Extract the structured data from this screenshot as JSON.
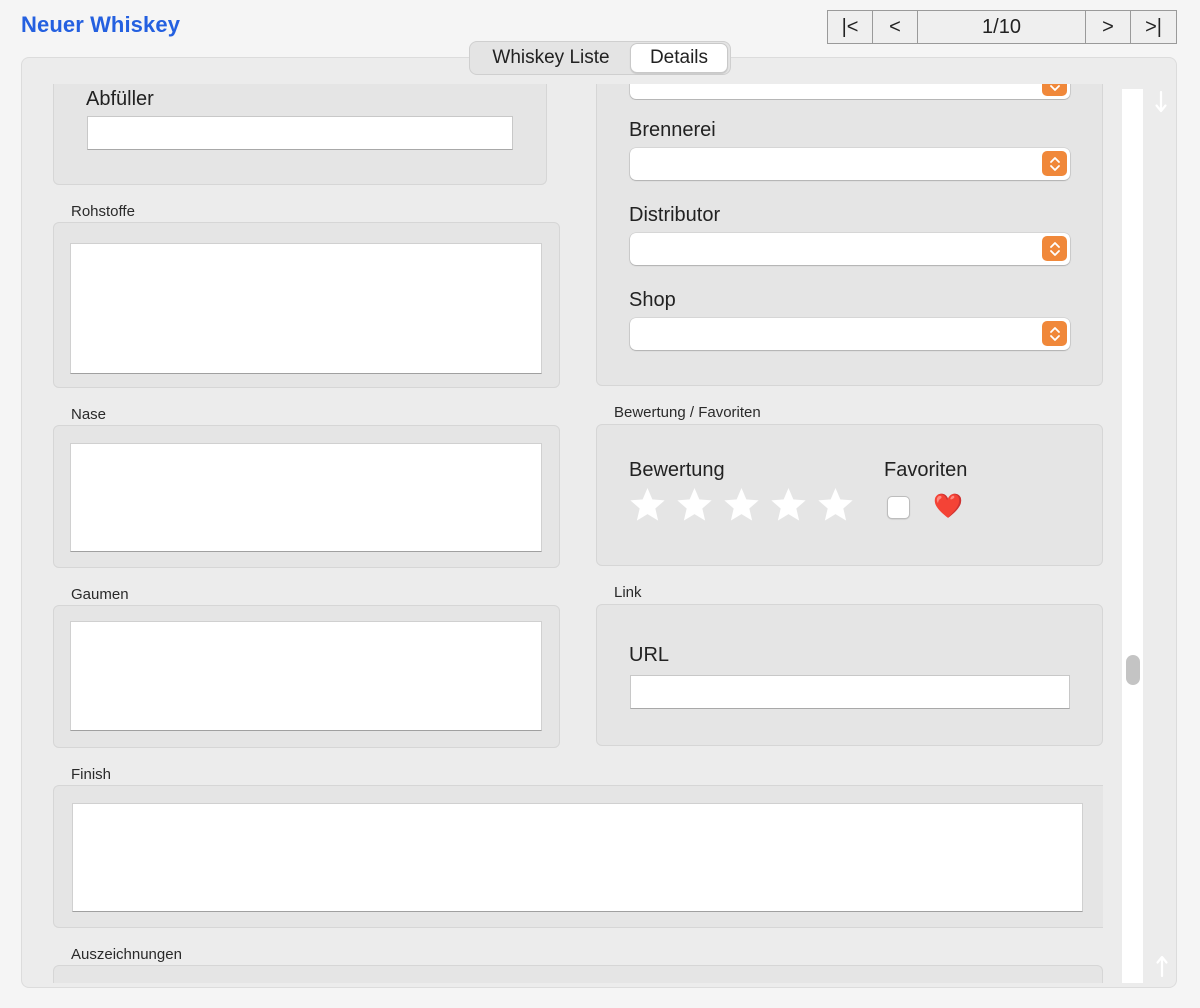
{
  "window": {
    "title": "Neuer Whiskey"
  },
  "navigation": {
    "first_label": "|<",
    "prev_label": "<",
    "counter": "1/10",
    "next_label": ">",
    "last_label": ">|"
  },
  "tabs": [
    {
      "label": "Whiskey Liste",
      "selected": false
    },
    {
      "label": "Details",
      "selected": true
    }
  ],
  "left_column": {
    "abfueller": {
      "label": "Abfüller",
      "value": ""
    },
    "rohstoffe": {
      "section_label": "Rohstoffe",
      "value": ""
    },
    "nase": {
      "section_label": "Nase",
      "value": ""
    },
    "gaumen": {
      "section_label": "Gaumen",
      "value": ""
    }
  },
  "right_column": {
    "dropdowns": [
      {
        "label": "Brennerei",
        "value": ""
      },
      {
        "label": "Distributor",
        "value": ""
      },
      {
        "label": "Shop",
        "value": ""
      }
    ],
    "rating_group": {
      "section_label": "Bewertung / Favoriten",
      "rating_label": "Bewertung",
      "rating_value": 0,
      "rating_max": 5,
      "favorites_label": "Favoriten",
      "favorite_checked": false,
      "heart_icon": "❤️"
    },
    "link_group": {
      "section_label": "Link",
      "url_label": "URL",
      "url_value": ""
    }
  },
  "finish": {
    "section_label": "Finish",
    "value": ""
  },
  "auszeichnungen": {
    "section_label": "Auszeichnungen"
  },
  "colors": {
    "title_blue": "#2460e0",
    "popup_orange": "#f0883a",
    "heart_red": "#e0263a"
  },
  "icons": {
    "popup_arrows": "chevron-up-down-icon",
    "star": "star-icon",
    "scroll_down": "arrow-down-icon",
    "scroll_up": "arrow-up-icon"
  }
}
